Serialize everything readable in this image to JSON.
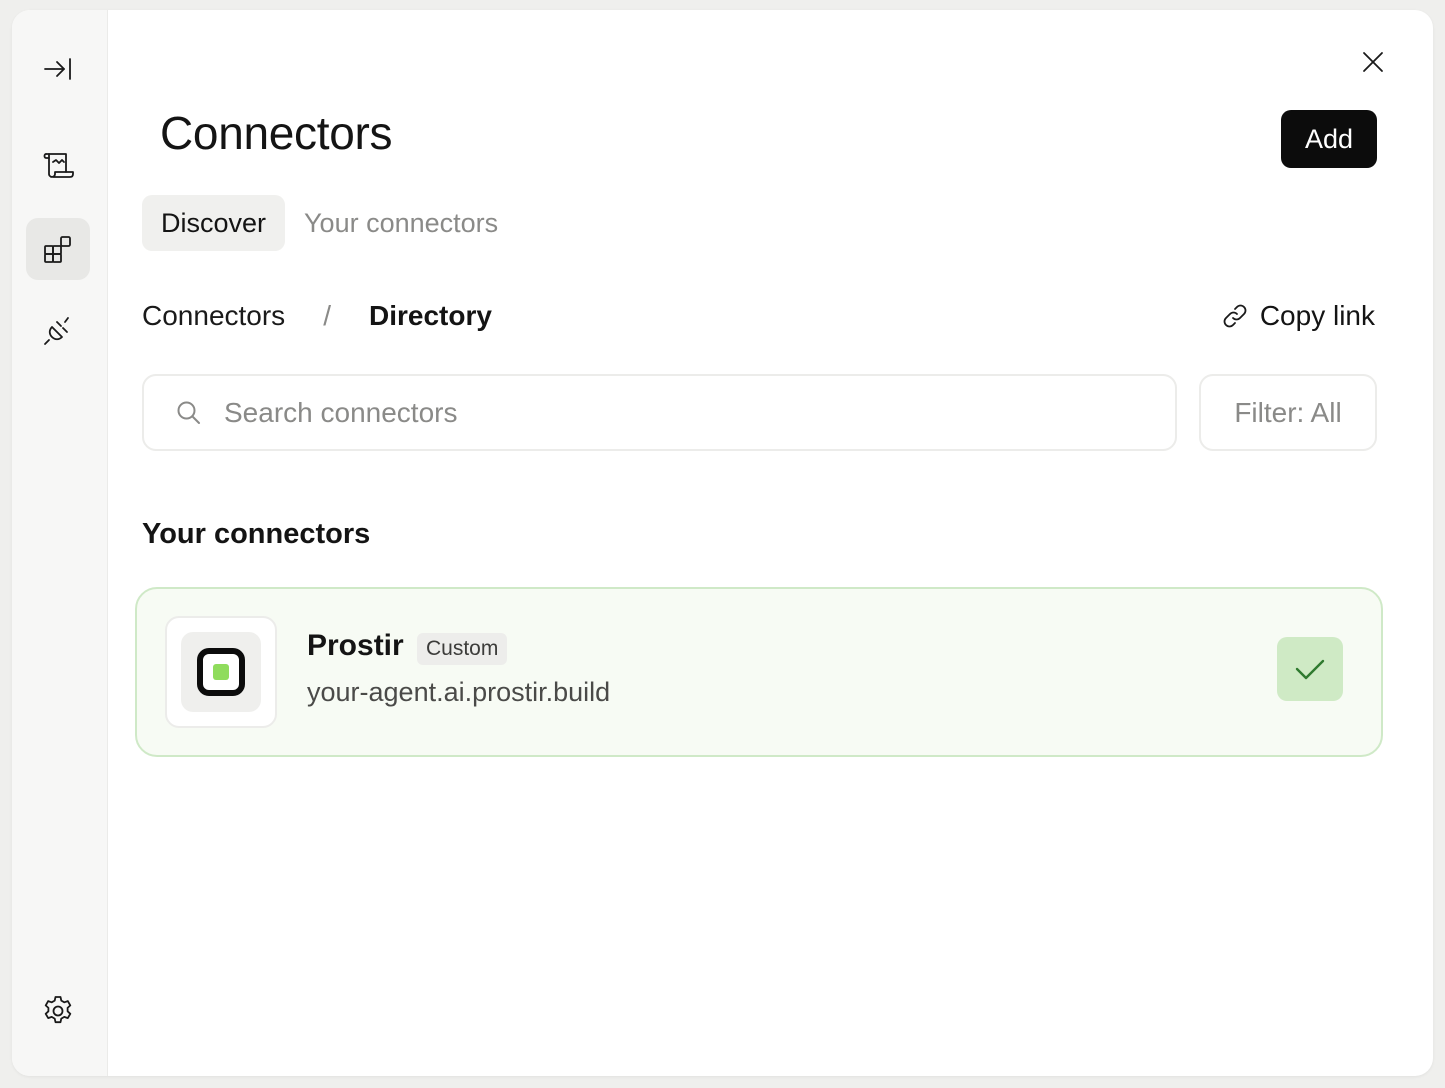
{
  "sidebar": {
    "items": [
      {
        "icon": "collapse-sidebar-icon"
      },
      {
        "icon": "scroll-icon"
      },
      {
        "icon": "connectors-grid-icon",
        "active": true
      },
      {
        "icon": "plug-icon"
      }
    ],
    "footer_icon": "gear-icon"
  },
  "header": {
    "title": "Connectors",
    "add_label": "Add",
    "close_icon": "close-icon"
  },
  "tabs": [
    {
      "label": "Discover",
      "active": true
    },
    {
      "label": "Your connectors",
      "active": false
    }
  ],
  "breadcrumb": {
    "root": "Connectors",
    "separator": "/",
    "current": "Directory"
  },
  "copy_link": {
    "label": "Copy link",
    "icon": "link-icon"
  },
  "search": {
    "placeholder": "Search connectors",
    "value": ""
  },
  "filter": {
    "label": "Filter: All"
  },
  "section": {
    "heading": "Your connectors"
  },
  "connectors": [
    {
      "name": "Prostir",
      "badge": "Custom",
      "url": "your-agent.ai.prostir.build",
      "status": "connected",
      "status_icon": "checkmark-icon"
    }
  ],
  "colors": {
    "accent_green": "#8fdc5c",
    "card_border": "#cfe9c7",
    "card_bg": "#f7fbf4",
    "check_bg": "#cfeac5",
    "primary_button": "#0c0c0c"
  }
}
